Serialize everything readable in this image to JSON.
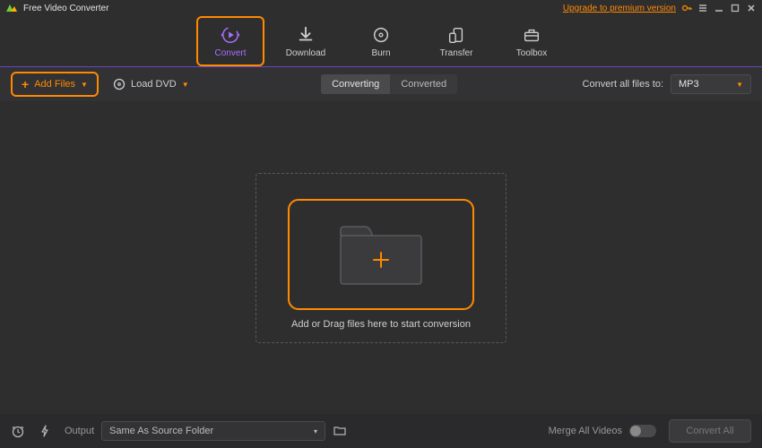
{
  "titlebar": {
    "app_title": "Free Video Converter",
    "upgrade_link": "Upgrade to premium version"
  },
  "topnav": {
    "convert": "Convert",
    "download": "Download",
    "burn": "Burn",
    "transfer": "Transfer",
    "toolbox": "Toolbox"
  },
  "actionbar": {
    "add_files": "Add Files",
    "load_dvd": "Load DVD",
    "tab_converting": "Converting",
    "tab_converted": "Converted",
    "convert_all_label": "Convert all files to:",
    "format_selected": "MP3"
  },
  "dropzone": {
    "text": "Add or Drag files here to start conversion"
  },
  "bottombar": {
    "output_label": "Output",
    "output_value": "Same As Source Folder",
    "merge_label": "Merge All Videos",
    "convert_all_btn": "Convert All"
  }
}
